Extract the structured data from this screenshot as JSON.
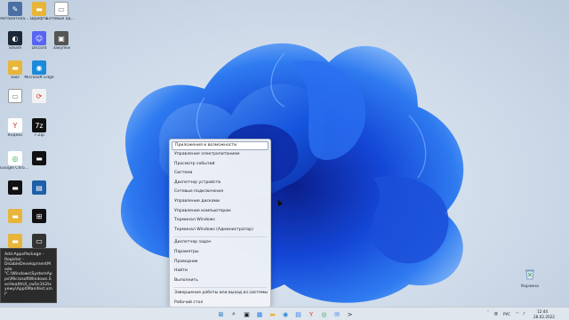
{
  "desktop_icons": [
    {
      "label": "Автоматизация",
      "icon": "tool-icon",
      "color": "#4a6fa5"
    },
    {
      "label": "Шрифты",
      "icon": "folder-icon",
      "color": "#e8b53a"
    },
    {
      "label": "Сетевые адреса",
      "icon": "document-icon",
      "color": "#ffffff"
    },
    {
      "label": "Steam",
      "icon": "steam-icon",
      "color": "#1b2838"
    },
    {
      "label": "Discord",
      "icon": "discord-icon",
      "color": "#5865f2"
    },
    {
      "label": "Закупки",
      "icon": "photo-icon",
      "color": "#555555"
    },
    {
      "label": "SSD",
      "icon": "folder-icon",
      "color": "#e8b53a"
    },
    {
      "label": "Microsoft Edge",
      "icon": "edge-icon",
      "color": "#1c8adb"
    },
    {
      "label": "",
      "icon": "document-icon",
      "color": "#ffffff"
    },
    {
      "label": "",
      "icon": "sync-icon",
      "color": "#f2f2f2"
    },
    {
      "label": "Яндекс",
      "icon": "yandex-icon",
      "color": "#ffffff"
    },
    {
      "label": "7-Zip",
      "icon": "7zip-icon",
      "color": "#111111"
    },
    {
      "label": "Google Chrome",
      "icon": "chrome-icon",
      "color": "#ffffff"
    },
    {
      "label": "",
      "icon": "terminal-icon",
      "color": "#111111"
    },
    {
      "label": "",
      "icon": "terminal-icon",
      "color": "#111111"
    },
    {
      "label": "",
      "icon": "app-icon",
      "color": "#1e5fa8"
    },
    {
      "label": "",
      "icon": "folder-icon",
      "color": "#e8b53a"
    },
    {
      "label": "",
      "icon": "windows-icon",
      "color": "#111111"
    },
    {
      "label": "",
      "icon": "folder-icon",
      "color": "#e8b53a"
    },
    {
      "label": "",
      "icon": "monitor-icon",
      "color": "#333333"
    },
    {
      "label": "",
      "icon": "folder-icon",
      "color": "#e8b53a"
    }
  ],
  "context_menu": {
    "items": [
      {
        "label": "Приложения и возможности",
        "hover": true
      },
      {
        "label": "Управление электропитанием"
      },
      {
        "label": "Просмотр событий"
      },
      {
        "label": "Система"
      },
      {
        "label": "Диспетчер устройств"
      },
      {
        "label": "Сетевые подключения"
      },
      {
        "label": "Управление дисками"
      },
      {
        "label": "Управление компьютером"
      },
      {
        "label": "Терминал Windows"
      },
      {
        "label": "Терминал Windows (Администратор)"
      },
      {
        "sep": true
      },
      {
        "label": "Диспетчер задач"
      },
      {
        "label": "Параметры"
      },
      {
        "label": "Проводник"
      },
      {
        "label": "Найти"
      },
      {
        "label": "Выполнить"
      },
      {
        "sep": true
      },
      {
        "label": "Завершение работы или выход из системы",
        "arrow": "›"
      },
      {
        "label": "Рабочий стол"
      }
    ]
  },
  "tooltip": {
    "text": "Add-AppxPackage -Register -DisableDevelopmentMode \"C:\\Windows\\SystemApps\\MicrosoftWindows.SecHealthUI_cw5n1h2txyewy\\AppXManifest.xml\""
  },
  "recycle_bin": {
    "label": "Корзина"
  },
  "taskbar": {
    "icons": [
      {
        "name": "start-icon",
        "glyph": "⊞",
        "color": "#0f6cbd"
      },
      {
        "name": "search-icon",
        "glyph": "⌕",
        "color": "#222222"
      },
      {
        "name": "task-view-icon",
        "glyph": "▣",
        "color": "#222222"
      },
      {
        "name": "widgets-icon",
        "glyph": "▦",
        "color": "#2b7de9"
      },
      {
        "name": "file-explorer-icon",
        "glyph": "▬",
        "color": "#e8b53a"
      },
      {
        "name": "edge-icon",
        "glyph": "◉",
        "color": "#1c8adb"
      },
      {
        "name": "store-icon",
        "glyph": "▤",
        "color": "#2b7de9"
      },
      {
        "name": "yandex-icon",
        "glyph": "Y",
        "color": "#e53935"
      },
      {
        "name": "chrome-icon",
        "glyph": "◎",
        "color": "#34a853"
      },
      {
        "name": "mail-icon",
        "glyph": "✉",
        "color": "#2b7de9"
      },
      {
        "name": "terminal-icon",
        "glyph": ">",
        "color": "#222222"
      }
    ],
    "tray": {
      "language": "РУС",
      "time": "12:44",
      "date": "28.02.2022"
    }
  }
}
